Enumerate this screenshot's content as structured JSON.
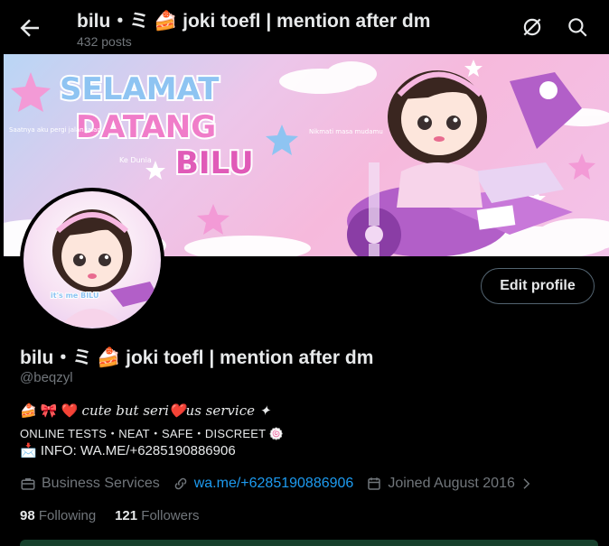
{
  "header": {
    "title": "bilu・ミ 🍰 joki toefl | mention after dm",
    "posts": "432 posts"
  },
  "banner": {
    "headline1": "SELAMAT",
    "headline2": "DATANG",
    "headline3": "BILU",
    "small_left": "Saatnya aku pergi jalan jalan",
    "small_right": "Nikmati masa mudamu",
    "ke_dunia": "Ke Dunia"
  },
  "avatar": {
    "badge": "it's me BILU"
  },
  "profile": {
    "edit_label": "Edit profile",
    "name": "bilu・ミ 🍰 joki toefl | mention after dm",
    "handle": "@beqzyl",
    "bio_emojis": "🍰 🎀 ❤️ ",
    "bio_script": "cute but seri❤️us service ✦",
    "bio_line2": "ONLINE TESTS・NEAT・SAFE・DISCREET 🍥",
    "bio_line3": "📩 INFO: WA.ME/+6285190886906",
    "category": "Business Services",
    "website": "wa.me/+6285190886906",
    "joined": "Joined August 2016",
    "following_count": "98",
    "following_label": "Following",
    "followers_count": "121",
    "followers_label": "Followers"
  },
  "colors": {
    "accent": "#1d9bf0",
    "muted": "#71767b",
    "text": "#e7e9ea"
  }
}
